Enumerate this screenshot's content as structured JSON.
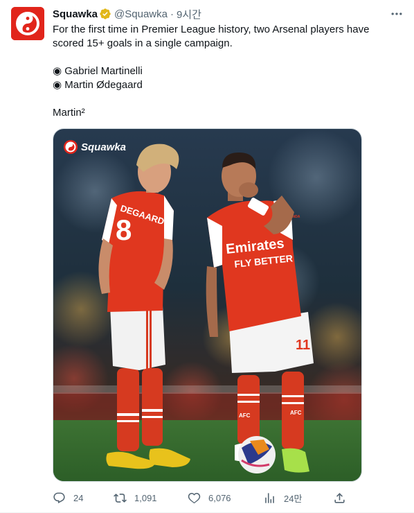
{
  "tweet": {
    "author_name": "Squawka",
    "author_handle": "@Squawka",
    "separator": "·",
    "time": "9시간",
    "text_lines": [
      "For the first time in Premier League history, two Arsenal players have",
      "scored 15+ goals in a single campaign."
    ],
    "list_items": [
      "◉ Gabriel Martinelli",
      "◉ Martin Ødegaard"
    ],
    "closing_line": "Martin²",
    "media": {
      "watermark": "Squawka",
      "jersey_number_left": "8",
      "name_on_shirt": "DEGAARD",
      "sponsor_line_1": "Emirates",
      "sponsor_line_2": "FLY BETTER",
      "number_right": "11",
      "sock_text": "AFC",
      "sleeve_text": "VISIT RWANDA"
    }
  },
  "actions": {
    "replies": "24",
    "retweets": "1,091",
    "likes": "6,076",
    "views": "24만"
  },
  "icons": {
    "avatar": "squawka-logo-icon",
    "verified": "verified-badge-icon",
    "more": "more-icon",
    "reply": "reply-icon",
    "retweet": "retweet-icon",
    "like": "heart-icon",
    "views": "views-icon",
    "share": "share-icon"
  },
  "colors": {
    "brand_red": "#e1251b",
    "verified_gold": "#e2b719",
    "muted_text": "#536471",
    "arsenal_red": "#e0371f"
  }
}
